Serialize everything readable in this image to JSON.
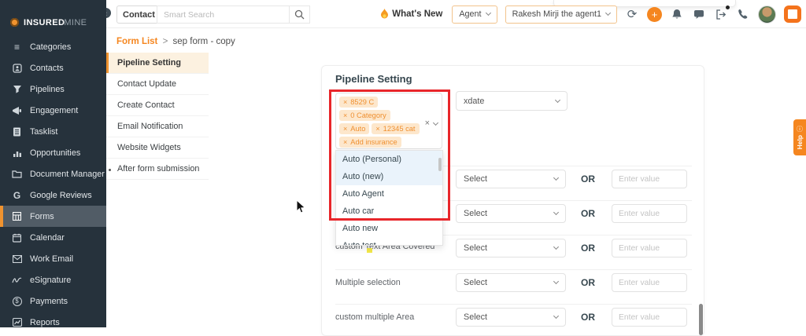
{
  "brand": {
    "name_bold": "INSURED",
    "name_light": "MINE"
  },
  "topbar": {
    "contact_label": "Contact",
    "search_placeholder": "Smart Search",
    "whats_new_label": "What's New",
    "agent_label": "Agent",
    "user_label": "Rakesh Mirji the agent1"
  },
  "sidebar": {
    "items": [
      {
        "label": "Categories"
      },
      {
        "label": "Contacts"
      },
      {
        "label": "Pipelines"
      },
      {
        "label": "Engagement"
      },
      {
        "label": "Tasklist"
      },
      {
        "label": "Opportunities"
      },
      {
        "label": "Document Manager"
      },
      {
        "label": "Google Reviews"
      },
      {
        "label": "Forms"
      },
      {
        "label": "Calendar"
      },
      {
        "label": "Work Email"
      },
      {
        "label": "eSignature"
      },
      {
        "label": "Payments"
      },
      {
        "label": "Reports"
      }
    ]
  },
  "breadcrumb": {
    "root": "Form List",
    "separator": ">",
    "current": "sep form - copy"
  },
  "form_nav": {
    "tabs": [
      {
        "label": "Pipeline Setting"
      },
      {
        "label": "Contact Update"
      },
      {
        "label": "Create Contact"
      },
      {
        "label": "Email Notification"
      },
      {
        "label": "Website Widgets"
      },
      {
        "label": "After form submission"
      }
    ]
  },
  "panel": {
    "title": "Pipeline Setting",
    "pipeline_multiselect": {
      "tags": [
        {
          "text": "8529 C"
        },
        {
          "text": "0 Category"
        },
        {
          "text": "Auto"
        },
        {
          "text": "12345 cat"
        },
        {
          "text": "Add insurance"
        },
        {
          "text": "Auto (Personal)"
        },
        {
          "text": "Auto (new)"
        }
      ],
      "options": [
        {
          "label": "Auto (Personal)"
        },
        {
          "label": "Auto (new)"
        },
        {
          "label": "Auto Agent"
        },
        {
          "label": "Auto car"
        },
        {
          "label": "Auto new"
        },
        {
          "label": "Auto test"
        }
      ]
    },
    "stage_select_value": "xdate",
    "rows": [
      {
        "label": "",
        "select_value": "Select",
        "or_label": "OR",
        "input_placeholder": "Enter value"
      },
      {
        "label": "",
        "select_value": "Select",
        "or_label": "OR",
        "input_placeholder": "Enter value"
      },
      {
        "label": "custom Text Area Covered",
        "select_value": "Select",
        "or_label": "OR",
        "input_placeholder": "Enter value"
      },
      {
        "label": "Multiple selection",
        "select_value": "Select",
        "or_label": "OR",
        "input_placeholder": "Enter value"
      },
      {
        "label": "custom multiple Area",
        "select_value": "Select",
        "or_label": "OR",
        "input_placeholder": "Enter value"
      }
    ]
  },
  "help_tab": {
    "label": "Help"
  },
  "icons": {
    "remove": "×",
    "clear": "×"
  },
  "colors": {
    "accent": "#f0932f",
    "highlight_red": "#e8262a",
    "tag_bg": "#fde7cc",
    "tag_text": "#ef9031",
    "option_highlight": "#eaf3fb",
    "sidebar_bg": "#26323c"
  }
}
